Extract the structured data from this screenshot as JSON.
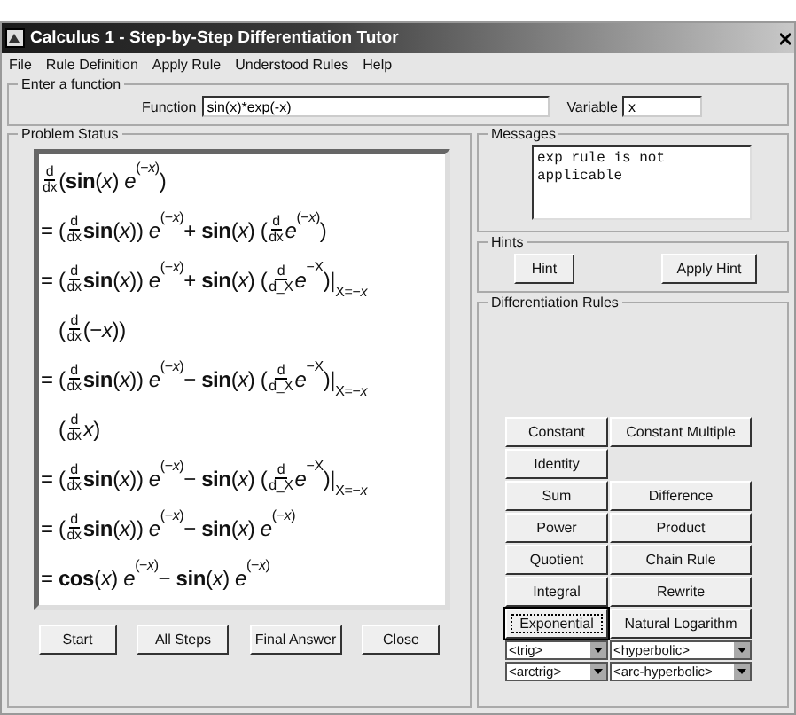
{
  "window": {
    "title": "Calculus 1 - Step-by-Step Differentiation Tutor"
  },
  "menu": [
    "File",
    "Rule Definition",
    "Apply Rule",
    "Understood Rules",
    "Help"
  ],
  "input_group": {
    "title": "Enter a function",
    "function_label": "Function",
    "function_value": "sin(x)*exp(-x)",
    "variable_label": "Variable",
    "variable_value": "x"
  },
  "problem_status": {
    "title": "Problem Status",
    "lines": [
      {
        "tokens": [
          {
            "kind": "frac",
            "num": "d",
            "den": "dx"
          },
          {
            "kind": "text",
            "text": "(**sin**(*x*) *e*"
          },
          {
            "kind": "sup",
            "text": "(−*x*)"
          },
          {
            "kind": "text",
            "text": ")"
          }
        ]
      },
      {
        "tokens": [
          {
            "kind": "text",
            "text": "= ("
          },
          {
            "kind": "frac",
            "num": "d",
            "den": "dx"
          },
          {
            "kind": "text",
            "text": "**sin**(*x*)) *e*"
          },
          {
            "kind": "sup",
            "text": "(−*x*)"
          },
          {
            "kind": "text",
            "text": " + **sin**(*x*) ("
          },
          {
            "kind": "frac",
            "num": "d",
            "den": "dx"
          },
          {
            "kind": "text",
            "text": "*e*"
          },
          {
            "kind": "sup",
            "text": "(−*x*)"
          },
          {
            "kind": "text",
            "text": ")"
          }
        ]
      },
      {
        "tokens": [
          {
            "kind": "text",
            "text": "= ("
          },
          {
            "kind": "frac",
            "num": "d",
            "den": "dx"
          },
          {
            "kind": "text",
            "text": "**sin**(*x*)) *e*"
          },
          {
            "kind": "sup",
            "text": "(−*x*)"
          },
          {
            "kind": "text",
            "text": " + **sin**(*x*) ("
          },
          {
            "kind": "frac",
            "num": "d",
            "den": "d_X"
          },
          {
            "kind": "text",
            "text": "*e*"
          },
          {
            "kind": "sup",
            "text": "−X"
          },
          {
            "kind": "text",
            "text": ")|"
          },
          {
            "kind": "sub",
            "text": "X=−*x*"
          }
        ],
        "continuation": [
          {
            "kind": "text",
            "text": "("
          },
          {
            "kind": "frac",
            "num": "d",
            "den": "dx"
          },
          {
            "kind": "text",
            "text": "(−*x*))"
          }
        ]
      },
      {
        "tokens": [
          {
            "kind": "text",
            "text": "= ("
          },
          {
            "kind": "frac",
            "num": "d",
            "den": "dx"
          },
          {
            "kind": "text",
            "text": "**sin**(*x*)) *e*"
          },
          {
            "kind": "sup",
            "text": "(−*x*)"
          },
          {
            "kind": "text",
            "text": " − **sin**(*x*) ("
          },
          {
            "kind": "frac",
            "num": "d",
            "den": "d_X"
          },
          {
            "kind": "text",
            "text": "*e*"
          },
          {
            "kind": "sup",
            "text": "−X"
          },
          {
            "kind": "text",
            "text": ")|"
          },
          {
            "kind": "sub",
            "text": "X=−*x*"
          }
        ],
        "continuation": [
          {
            "kind": "text",
            "text": "("
          },
          {
            "kind": "frac",
            "num": "d",
            "den": "dx"
          },
          {
            "kind": "text",
            "text": "*x*)"
          }
        ]
      },
      {
        "tokens": [
          {
            "kind": "text",
            "text": "= ("
          },
          {
            "kind": "frac",
            "num": "d",
            "den": "dx"
          },
          {
            "kind": "text",
            "text": "**sin**(*x*)) *e*"
          },
          {
            "kind": "sup",
            "text": "(−*x*)"
          },
          {
            "kind": "text",
            "text": " − **sin**(*x*) ("
          },
          {
            "kind": "frac",
            "num": "d",
            "den": "d_X"
          },
          {
            "kind": "text",
            "text": "*e*"
          },
          {
            "kind": "sup",
            "text": "−X"
          },
          {
            "kind": "text",
            "text": ")|"
          },
          {
            "kind": "sub",
            "text": "X=−*x*"
          }
        ]
      },
      {
        "tokens": [
          {
            "kind": "text",
            "text": "= ("
          },
          {
            "kind": "frac",
            "num": "d",
            "den": "dx"
          },
          {
            "kind": "text",
            "text": "**sin**(*x*)) *e*"
          },
          {
            "kind": "sup",
            "text": "(−*x*)"
          },
          {
            "kind": "text",
            "text": " − **sin**(*x*) *e*"
          },
          {
            "kind": "sup",
            "text": "(−*x*)"
          }
        ]
      },
      {
        "tokens": [
          {
            "kind": "text",
            "text": "= **cos**(*x*) *e*"
          },
          {
            "kind": "sup",
            "text": "(−*x*)"
          },
          {
            "kind": "text",
            "text": " − **sin**(*x*) *e*"
          },
          {
            "kind": "sup",
            "text": "(−*x*)"
          }
        ]
      }
    ],
    "buttons": [
      "Start",
      "All Steps",
      "Final Answer",
      "Close"
    ]
  },
  "messages": {
    "title": "Messages",
    "text": "exp rule is not\napplicable"
  },
  "hints": {
    "title": "Hints",
    "buttons": [
      "Hint",
      "Apply Hint"
    ]
  },
  "rules": {
    "title": "Differentiation Rules",
    "rows": [
      [
        {
          "kind": "button",
          "label": "Constant",
          "focused": false
        },
        {
          "kind": "button",
          "label": "Constant Multiple",
          "focused": false
        }
      ],
      [
        {
          "kind": "button",
          "label": "Identity",
          "focused": false
        }
      ],
      [
        {
          "kind": "button",
          "label": "Sum",
          "focused": false
        },
        {
          "kind": "button",
          "label": "Difference",
          "focused": false
        }
      ],
      [
        {
          "kind": "button",
          "label": "Power",
          "focused": false
        },
        {
          "kind": "button",
          "label": "Product",
          "focused": false
        }
      ],
      [
        {
          "kind": "button",
          "label": "Quotient",
          "focused": false
        },
        {
          "kind": "button",
          "label": "Chain Rule",
          "focused": false
        }
      ],
      [
        {
          "kind": "button",
          "label": "Integral",
          "focused": false
        },
        {
          "kind": "button",
          "label": "Rewrite",
          "focused": false
        }
      ],
      [
        {
          "kind": "button",
          "label": "Exponential",
          "focused": true
        },
        {
          "kind": "button",
          "label": "Natural Logarithm",
          "focused": false
        }
      ],
      [
        {
          "kind": "select",
          "label": "<trig>",
          "focused": false
        },
        {
          "kind": "select",
          "label": "<hyperbolic>",
          "focused": false
        }
      ],
      [
        {
          "kind": "select",
          "label": "<arctrig>",
          "focused": false
        },
        {
          "kind": "select",
          "label": "<arc-hyperbolic>",
          "focused": false
        }
      ]
    ]
  }
}
